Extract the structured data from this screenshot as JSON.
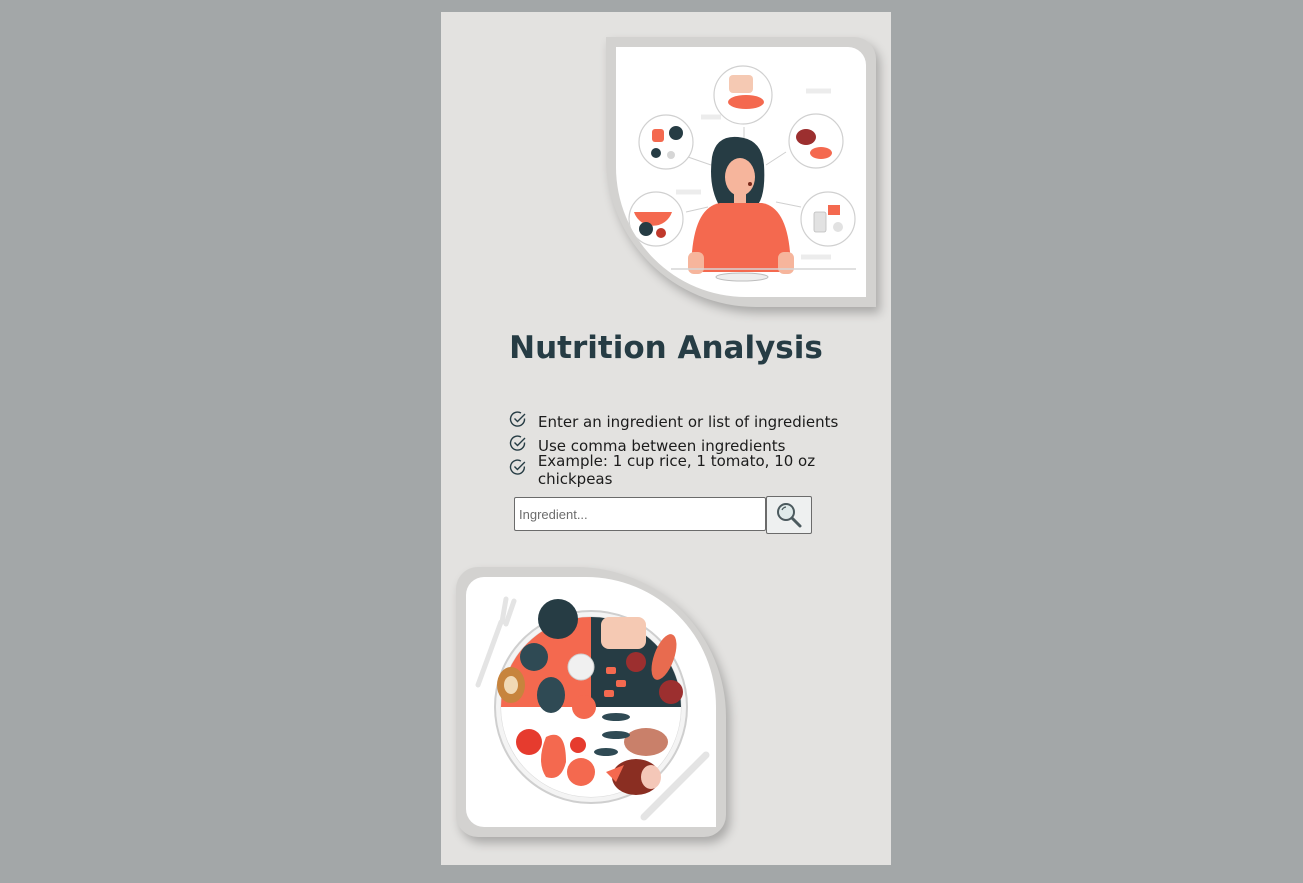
{
  "page": {
    "title": "Nutrition Analysis"
  },
  "instructions": [
    "Enter an ingredient or list of ingredients",
    "Use comma between ingredients",
    "Example: 1 cup rice, 1 tomato, 10 oz chickpeas"
  ],
  "search": {
    "placeholder": "Ingredient...",
    "value": "",
    "button_icon": "search-icon"
  },
  "illustrations": {
    "top": "woman-with-food-choices-illustration",
    "bottom": "food-plate-illustration"
  },
  "colors": {
    "background": "#a3a7a8",
    "panel": "#e3e2e0",
    "title": "#263c44",
    "accent": "#f4694f",
    "dark_accent": "#263c44"
  }
}
